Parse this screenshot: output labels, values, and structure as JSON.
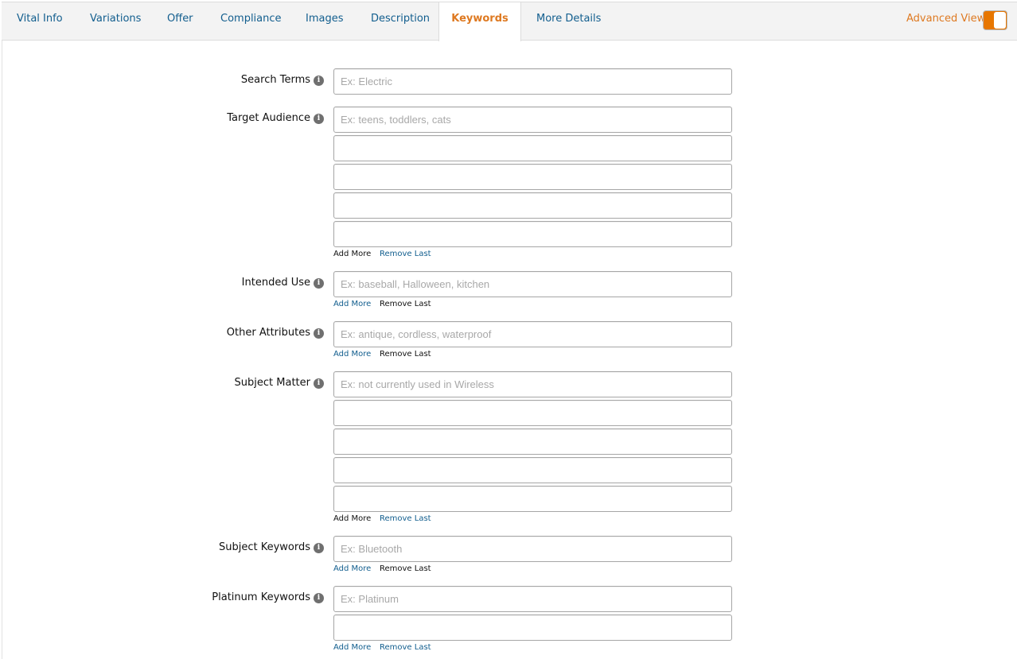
{
  "tabs": [
    {
      "label": "Vital Info"
    },
    {
      "label": "Variations"
    },
    {
      "label": "Offer"
    },
    {
      "label": "Compliance"
    },
    {
      "label": "Images"
    },
    {
      "label": "Description"
    },
    {
      "label": "Keywords",
      "active": true
    },
    {
      "label": "More Details"
    }
  ],
  "advanced_view": {
    "label": "Advanced View",
    "enabled": true
  },
  "colors": {
    "accent": "#de7921",
    "link": "#125e8e"
  },
  "info_icon": "i",
  "fields": [
    {
      "label": "Search Terms",
      "placeholder": "Ex: Electric",
      "inputs": 1
    },
    {
      "label": "Target Audience",
      "placeholder": "Ex: teens, toddlers, cats",
      "inputs": 5,
      "add_more": "Add More",
      "remove_last": "Remove Last"
    },
    {
      "label": "Intended Use",
      "placeholder": "Ex: baseball, Halloween, kitchen",
      "inputs": 1,
      "add_more": "Add More",
      "remove_last": "Remove Last"
    },
    {
      "label": "Other Attributes",
      "placeholder": "Ex: antique, cordless, waterproof",
      "inputs": 1,
      "add_more": "Add More",
      "remove_last": "Remove Last"
    },
    {
      "label": "Subject Matter",
      "placeholder": "Ex: not currently used in Wireless",
      "inputs": 5,
      "add_more": "Add More",
      "remove_last": "Remove Last"
    },
    {
      "label": "Subject Keywords",
      "placeholder": "Ex: Bluetooth",
      "inputs": 1,
      "add_more": "Add More",
      "remove_last": "Remove Last"
    },
    {
      "label": "Platinum Keywords",
      "placeholder": "Ex: Platinum",
      "inputs": 2,
      "add_more": "Add More",
      "remove_last": "Remove Last"
    }
  ]
}
